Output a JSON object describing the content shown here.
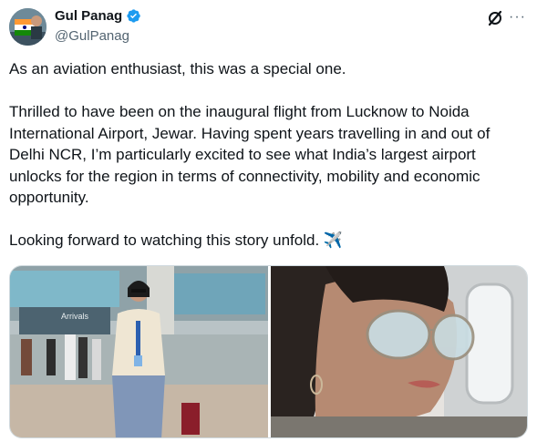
{
  "author": {
    "display_name": "Gul Panag",
    "handle": "@GulPanag",
    "avatar_icon": "profile-avatar",
    "verified_icon": "verified-badge-icon",
    "verified_color": "#1d9bf0"
  },
  "toolbar": {
    "grok_icon": "grok-slash-icon",
    "more_icon": "more-options-icon",
    "more_label": "···"
  },
  "tweet": {
    "text": "As an aviation enthusiast, this was a special one.\n\nThrilled to have been on the inaugural flight from Lucknow to Noida International Airport, Jewar. Having spent years travelling in and out of Delhi NCR, I’m particularly excited to see what India’s largest airport unlocks for the region in terms of connectivity, mobility and economic opportunity.\n\nLooking forward to watching this story unfold. ✈️"
  },
  "media": {
    "photos": [
      {
        "alt": "Woman in airport terminal with Arrivals sign"
      },
      {
        "alt": "Close-up of woman wearing aviator sunglasses by airplane window"
      }
    ],
    "left_sign": "Arrivals"
  }
}
